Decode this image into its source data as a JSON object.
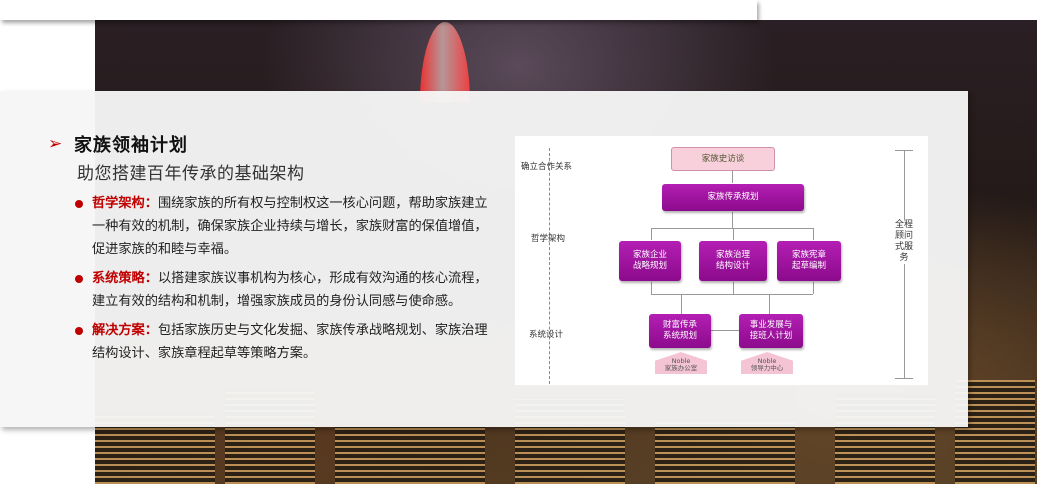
{
  "heading": "家族领袖计划",
  "subtitle": "助您搭建百年传承的基础架构",
  "bullets": [
    {
      "title": "哲学架构：",
      "text": "围绕家族的所有权与控制权这一核心问题，帮助家族建立一种有效的机制，确保家族企业持续与增长，家族财富的保值增值，促进家族的和睦与幸福。"
    },
    {
      "title": "系统策略：",
      "text": "以搭建家族议事机构为核心，形成有效沟通的核心流程，建立有效的结构和机制，增强家族成员的身份认同感与使命感。"
    },
    {
      "title": "解决方案：",
      "text": "包括家族历史与文化发掘、家族传承战略规划、家族治理结构设计、家族章程起草等策略方案。"
    }
  ],
  "diagram": {
    "left_labels": [
      "确立合作关系",
      "哲学架构",
      "系统设计"
    ],
    "right_label": "全程顾问式服务",
    "top_box": "家族史访谈",
    "main_box": "家族传承规划",
    "mid_boxes": [
      "家族企业\n战略规划",
      "家族治理\n结构设计",
      "家族宪章\n起草编制"
    ],
    "bottom_boxes": [
      "财富传承\n系统规划",
      "事业发展与\n接班人计划"
    ],
    "offices": [
      {
        "brand": "Noble",
        "name": "家族办公室"
      },
      {
        "brand": "Noble",
        "name": "领导力中心"
      }
    ]
  },
  "colors": {
    "accent": "#c00000",
    "box": "#a014a0",
    "top_box": "#f7d0dc"
  }
}
